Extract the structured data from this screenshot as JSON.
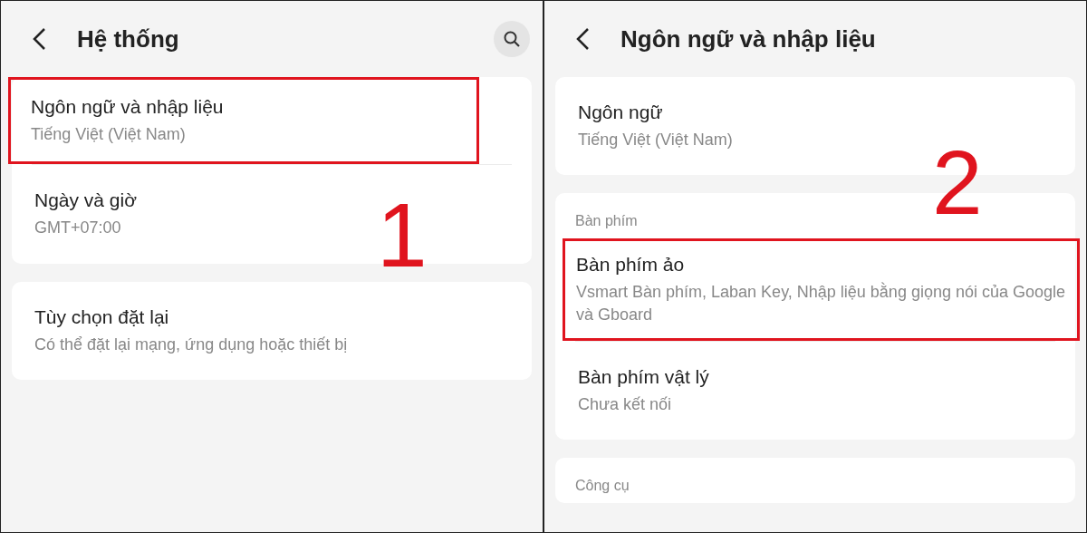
{
  "panels": [
    {
      "title": "Hệ thống",
      "search": true,
      "step": "1",
      "cards": [
        {
          "items": [
            {
              "title": "Ngôn ngữ và nhập liệu",
              "subtitle": "Tiếng Việt (Việt Nam)",
              "highlighted": true
            },
            {
              "title": "Ngày và giờ",
              "subtitle": "GMT+07:00",
              "highlighted": false
            }
          ]
        },
        {
          "items": [
            {
              "title": "Tùy chọn đặt lại",
              "subtitle": "Có thể đặt lại mạng, ứng dụng hoặc thiết bị",
              "highlighted": false
            }
          ]
        }
      ]
    },
    {
      "title": "Ngôn ngữ và nhập liệu",
      "search": false,
      "step": "2",
      "cards": [
        {
          "items": [
            {
              "title": "Ngôn ngữ",
              "subtitle": "Tiếng Việt (Việt Nam)",
              "highlighted": false
            }
          ]
        },
        {
          "header": "Bàn phím",
          "items": [
            {
              "title": "Bàn phím ảo",
              "subtitle": "Vsmart Bàn phím, Laban Key, Nhập liệu bằng giọng nói của Google và Gboard",
              "highlighted": true
            },
            {
              "title": "Bàn phím vật lý",
              "subtitle": "Chưa kết nối",
              "highlighted": false
            }
          ]
        },
        {
          "header": "Công cụ"
        }
      ]
    }
  ]
}
